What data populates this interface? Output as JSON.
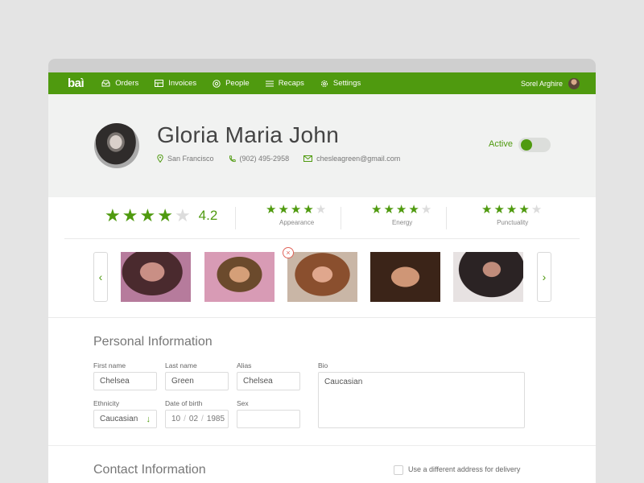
{
  "nav": {
    "logo": "baì",
    "items": [
      {
        "label": "Orders",
        "icon": "inbox-icon"
      },
      {
        "label": "Invoices",
        "icon": "invoice-icon"
      },
      {
        "label": "People",
        "icon": "people-icon"
      },
      {
        "label": "Recaps",
        "icon": "list-icon"
      },
      {
        "label": "Settings",
        "icon": "gear-icon"
      }
    ],
    "user_name": "Sorel Arghire"
  },
  "profile": {
    "name": "Gloria Maria John",
    "location": "San Francisco",
    "phone": "(902) 495-2958",
    "email": "chesleagreen@gmail.com",
    "status": "Active",
    "active": true
  },
  "ratings": {
    "overall": {
      "score": "4.2",
      "stars": 4,
      "max": 5
    },
    "categories": [
      {
        "label": "Appearance",
        "stars": 4,
        "max": 5
      },
      {
        "label": "Energy",
        "stars": 4,
        "max": 5
      },
      {
        "label": "Punctuality",
        "stars": 4,
        "max": 5
      }
    ]
  },
  "gallery": {
    "prev": "‹",
    "next": "›",
    "remove": "×",
    "photo_count": 5
  },
  "personal": {
    "title": "Personal Information",
    "first_name": {
      "label": "First name",
      "value": "Chelsea"
    },
    "last_name": {
      "label": "Last name",
      "value": "Green"
    },
    "alias": {
      "label": "Alias",
      "value": "Chelsea"
    },
    "bio": {
      "label": "Bio",
      "value": "Caucasian"
    },
    "ethnicity": {
      "label": "Ethnicity",
      "value": "Caucasian"
    },
    "dob": {
      "label": "Date of birth",
      "day": "10",
      "month": "02",
      "year": "1985"
    },
    "sex": {
      "label": "Sex",
      "value": ""
    }
  },
  "contact": {
    "title": "Contact Information",
    "delivery_checkbox": "Use a different address for delivery"
  },
  "colors": {
    "accent": "#4f9a0f",
    "danger": "#e0645a"
  }
}
